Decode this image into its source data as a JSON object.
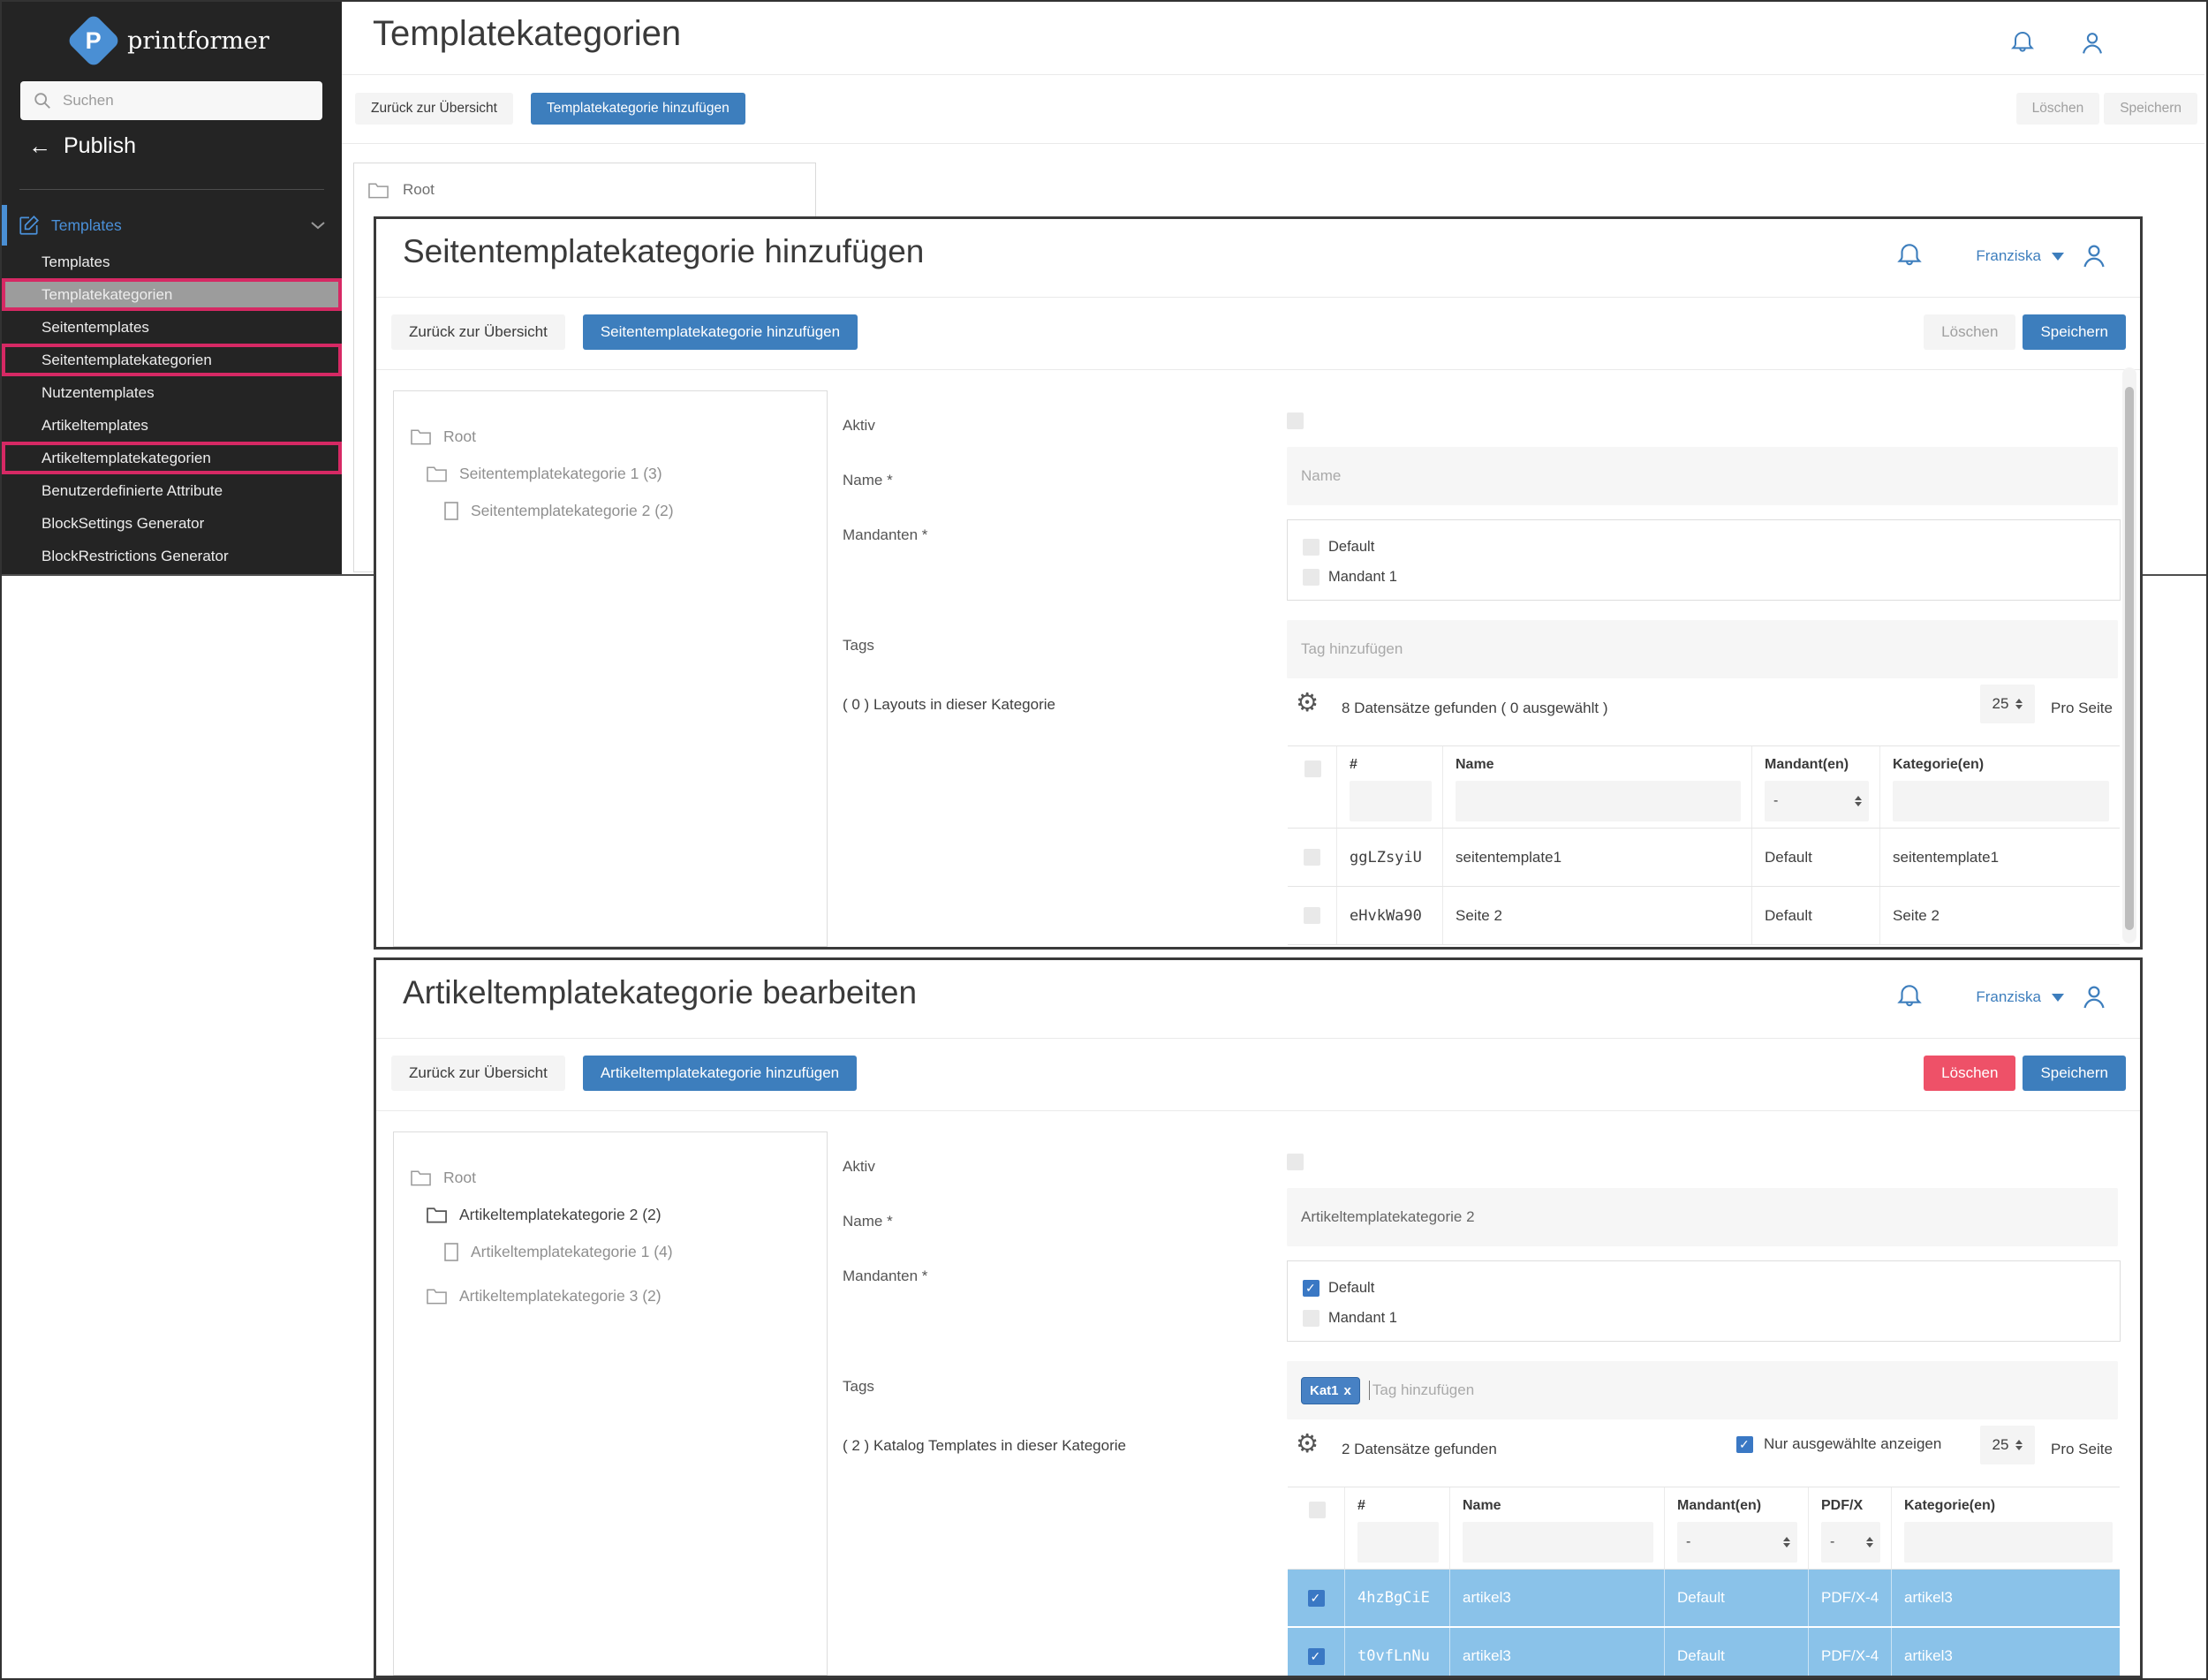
{
  "colors": {
    "accent_blue": "#3d7ebd",
    "danger_red": "#ee5168",
    "selected_row_blue": "#8ac2e9",
    "annotation_pink": "#d62964",
    "sidebar_bg": "#242424",
    "tag_blue": "#4781c4"
  },
  "sidebar": {
    "logo_text": "printformer",
    "logo_letter": "P",
    "search_placeholder": "Suchen",
    "back_label": "Publish",
    "section_label": "Templates",
    "items": [
      {
        "label": "Templates"
      },
      {
        "label": "Templatekategorien",
        "highlighted": true,
        "annotated": true
      },
      {
        "label": "Seitentemplates"
      },
      {
        "label": "Seitentemplatekategorien",
        "annotated": true
      },
      {
        "label": "Nutzentemplates"
      },
      {
        "label": "Artikeltemplates"
      },
      {
        "label": "Artikeltemplatekategorien",
        "annotated": true
      },
      {
        "label": "Benutzerdefinierte Attribute"
      },
      {
        "label": "BlockSettings Generator"
      },
      {
        "label": "BlockRestrictions Generator"
      }
    ]
  },
  "background_page": {
    "title": "Templatekategorien",
    "buttons": {
      "back": "Zurück zur Übersicht",
      "add": "Templatekategorie hinzufügen",
      "delete": "Löschen",
      "save": "Speichern"
    },
    "tree_root": "Root"
  },
  "window1": {
    "title": "Seitentemplatekategorie hinzufügen",
    "user_name": "Franziska",
    "buttons": {
      "back": "Zurück zur Übersicht",
      "add": "Seitentemplatekategorie hinzufügen",
      "delete": "Löschen",
      "save": "Speichern"
    },
    "tree": [
      {
        "label": "Root"
      },
      {
        "label": "Seitentemplatekategorie 1 (3)"
      },
      {
        "label": "Seitentemplatekategorie 2 (2)"
      }
    ],
    "form": {
      "aktiv_label": "Aktiv",
      "aktiv_checked": false,
      "name_label": "Name *",
      "name_placeholder": "Name",
      "name_value": "",
      "mandanten_label": "Mandanten *",
      "mandanten": [
        {
          "label": "Default",
          "checked": false
        },
        {
          "label": "Mandant 1",
          "checked": false
        }
      ],
      "tags_label": "Tags",
      "tags_placeholder": "Tag hinzufügen",
      "count_label": "( 0 ) Layouts in dieser Kategorie"
    },
    "table": {
      "summary": "8 Datensätze gefunden ( 0 ausgewählt )",
      "per_page": "25",
      "per_page_label": "Pro Seite",
      "mandant_filter": "-",
      "columns": [
        "#",
        "Name",
        "Mandant(en)",
        "Kategorie(en)"
      ],
      "rows": [
        {
          "selected": false,
          "id": "ggLZsyiU",
          "name": "seitentemplate1",
          "mandant": "Default",
          "kategorie": "seitentemplate1"
        },
        {
          "selected": false,
          "id": "eHvkWa90",
          "name": "Seite 2",
          "mandant": "Default",
          "kategorie": "Seite 2"
        }
      ]
    }
  },
  "window2": {
    "title": "Artikeltemplatekategorie bearbeiten",
    "user_name": "Franziska",
    "buttons": {
      "back": "Zurück zur Übersicht",
      "add": "Artikeltemplatekategorie hinzufügen",
      "delete": "Löschen",
      "save": "Speichern"
    },
    "tree": [
      {
        "label": "Root"
      },
      {
        "label": "Artikeltemplatekategorie 2 (2)",
        "selected": true
      },
      {
        "label": "Artikeltemplatekategorie 1 (4)"
      },
      {
        "label": "Artikeltemplatekategorie 3 (2)"
      }
    ],
    "form": {
      "aktiv_label": "Aktiv",
      "aktiv_checked": false,
      "name_label": "Name *",
      "name_value": "Artikeltemplatekategorie 2",
      "mandanten_label": "Mandanten *",
      "mandanten": [
        {
          "label": "Default",
          "checked": true
        },
        {
          "label": "Mandant 1",
          "checked": false
        }
      ],
      "tags_label": "Tags",
      "tag_chip": "Kat1",
      "tag_chip_close": "x",
      "tags_placeholder": "Tag hinzufügen",
      "count_label": "( 2 ) Katalog Templates in dieser Kategorie"
    },
    "table": {
      "summary": "2 Datensätze gefunden",
      "only_selected_label": "Nur ausgewählte anzeigen",
      "only_selected_checked": true,
      "per_page": "25",
      "per_page_label": "Pro Seite",
      "mandant_filter": "-",
      "pdfx_filter": "-",
      "columns": [
        "#",
        "Name",
        "Mandant(en)",
        "PDF/X",
        "Kategorie(en)"
      ],
      "rows": [
        {
          "selected": true,
          "id": "4hzBgCiE",
          "name": "artikel3",
          "mandant": "Default",
          "pdfx": "PDF/X-4",
          "kategorie": "artikel3"
        },
        {
          "selected": true,
          "id": "t0vfLnNu",
          "name": "artikel3",
          "mandant": "Default",
          "pdfx": "PDF/X-4",
          "kategorie": "artikel3"
        }
      ]
    }
  }
}
